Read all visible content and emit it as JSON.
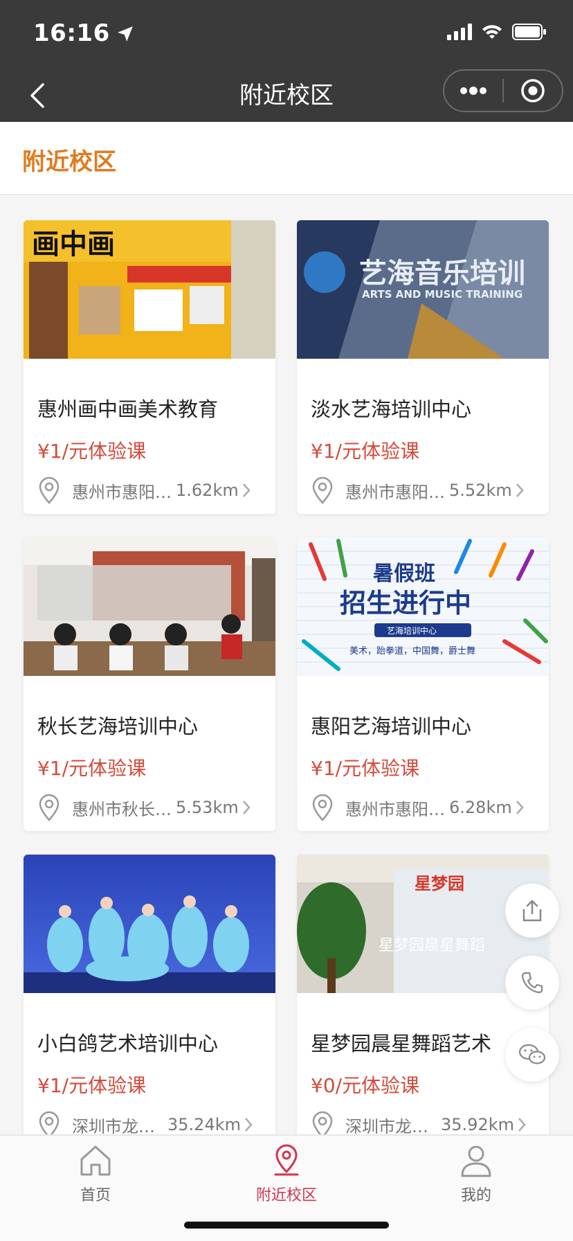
{
  "status": {
    "time": "16:16"
  },
  "nav": {
    "title": "附近校区"
  },
  "section": {
    "title": "附近校区"
  },
  "cards": [
    {
      "name": "惠州画中画美术教育",
      "price": "¥1/元体验课",
      "address": "惠州市惠阳…",
      "distance": "1.62km",
      "image_text": "画中画"
    },
    {
      "name": "淡水艺海培训中心",
      "price": "¥1/元体验课",
      "address": "惠州市惠阳…",
      "distance": "5.52km",
      "image_text": "艺海音乐培训",
      "image_subtext": "ARTS AND MUSIC TRAINING"
    },
    {
      "name": "秋长艺海培训中心",
      "price": "¥1/元体验课",
      "address": "惠州市秋长…",
      "distance": "5.53km"
    },
    {
      "name": "惠阳艺海培训中心",
      "price": "¥1/元体验课",
      "address": "惠州市惠阳…",
      "distance": "6.28km",
      "image_text": "暑假班",
      "image_text2": "招生进行中",
      "image_subtext": "艺海培训中心",
      "image_subtext2": "美术，跆拳道，中国舞，爵士舞"
    },
    {
      "name": "小白鸽艺术培训中心",
      "price": "¥1/元体验课",
      "address": "深圳市龙…",
      "distance": "35.24km"
    },
    {
      "name": "星梦园晨星舞蹈艺术",
      "price": "¥0/元体验课",
      "address": "深圳市龙…",
      "distance": "35.92km",
      "image_text": "星梦园",
      "image_text2": "星梦园晨星舞蹈"
    }
  ],
  "tabs": [
    {
      "label": "首页",
      "active": false
    },
    {
      "label": "附近校区",
      "active": true
    },
    {
      "label": "我的",
      "active": false
    }
  ],
  "colors": {
    "accent": "#e07b1f",
    "price": "#d44a3a",
    "active_tab": "#d2334f",
    "header": "#3a3a3a"
  }
}
